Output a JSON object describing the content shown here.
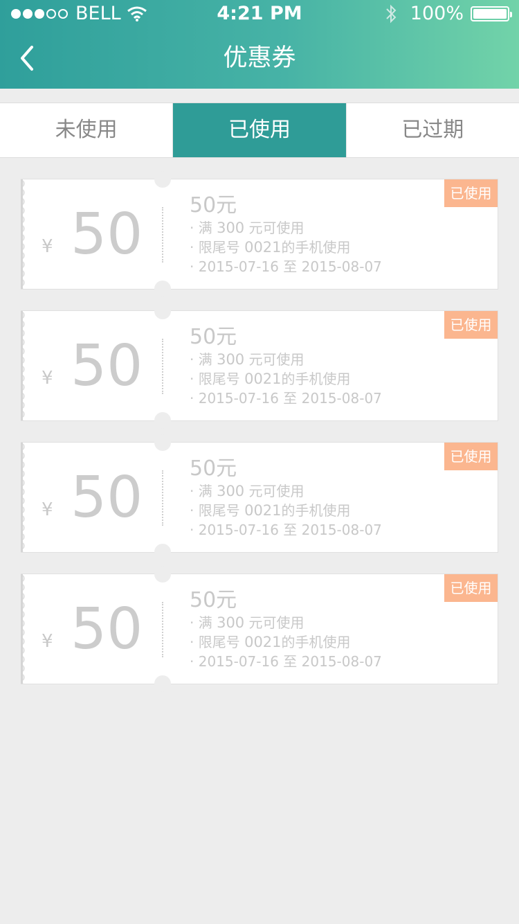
{
  "status_bar": {
    "carrier": "BELL",
    "time": "4:21 PM",
    "battery": "100%"
  },
  "nav": {
    "title": "优惠券"
  },
  "tabs": [
    {
      "label": "未使用"
    },
    {
      "label": "已使用"
    },
    {
      "label": "已过期"
    }
  ],
  "coupons": [
    {
      "currency": "¥",
      "amount": "50",
      "name": "50元",
      "badge": "已使用",
      "cond_prefix": "· 满 ",
      "cond_value": "300",
      "cond_suffix": " 元可使用",
      "phone_prefix": "· 限尾号 ",
      "phone_value": "0021",
      "phone_suffix": "的手机使用",
      "date_range": "· 2015-07-16 至 2015-08-07"
    },
    {
      "currency": "¥",
      "amount": "50",
      "name": "50元",
      "badge": "已使用",
      "cond_prefix": "· 满 ",
      "cond_value": "300",
      "cond_suffix": " 元可使用",
      "phone_prefix": "· 限尾号 ",
      "phone_value": "0021",
      "phone_suffix": "的手机使用",
      "date_range": "· 2015-07-16 至 2015-08-07"
    },
    {
      "currency": "¥",
      "amount": "50",
      "name": "50元",
      "badge": "已使用",
      "cond_prefix": "· 满 ",
      "cond_value": "300",
      "cond_suffix": " 元可使用",
      "phone_prefix": "· 限尾号 ",
      "phone_value": "0021",
      "phone_suffix": "的手机使用",
      "date_range": "· 2015-07-16 至 2015-08-07"
    },
    {
      "currency": "¥",
      "amount": "50",
      "name": "50元",
      "badge": "已使用",
      "cond_prefix": "· 满 ",
      "cond_value": "300",
      "cond_suffix": " 元可使用",
      "phone_prefix": "· 限尾号 ",
      "phone_value": "0021",
      "phone_suffix": "的手机使用",
      "date_range": "· 2015-07-16 至 2015-08-07"
    }
  ]
}
